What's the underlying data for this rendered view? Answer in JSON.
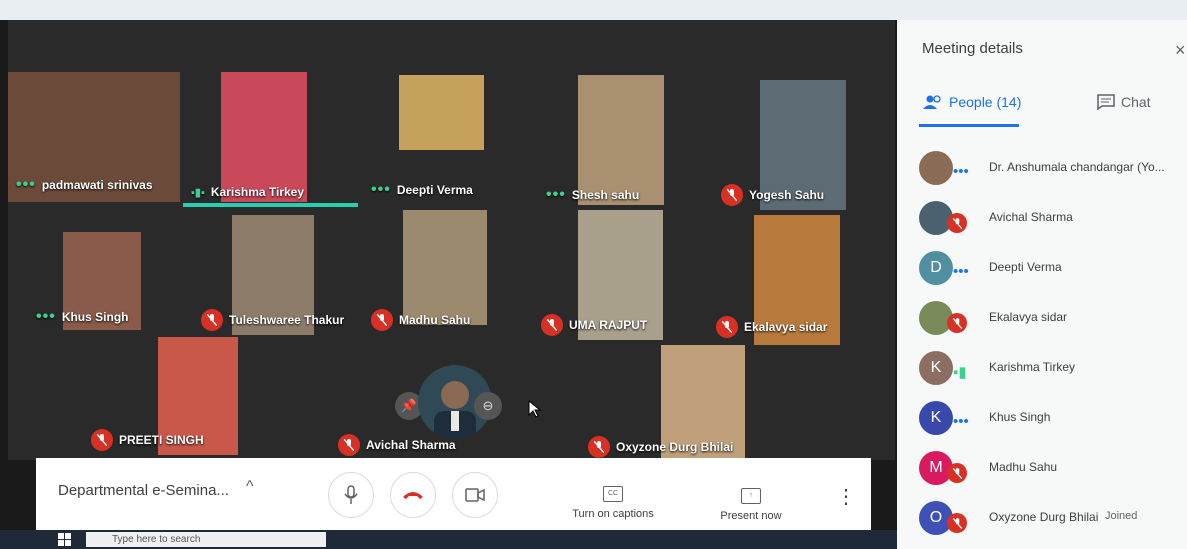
{
  "tiles": [
    {
      "name": "padmawati srinivas",
      "status": "dots"
    },
    {
      "name": "Karishma Tirkey",
      "status": "speaking"
    },
    {
      "name": "Deepti Verma",
      "status": "dots"
    },
    {
      "name": "Shesh sahu",
      "status": "dots"
    },
    {
      "name": "Yogesh Sahu",
      "status": "muted"
    },
    {
      "name": "Khus Singh",
      "status": "dots"
    },
    {
      "name": "Tuleshwaree Thakur",
      "status": "muted"
    },
    {
      "name": "Madhu Sahu",
      "status": "muted"
    },
    {
      "name": "UMA RAJPUT",
      "status": "muted"
    },
    {
      "name": "Ekalavya sidar",
      "status": "muted"
    },
    {
      "name": "PREETI SINGH",
      "status": "muted"
    },
    {
      "name": "Avichal Sharma",
      "status": "muted"
    },
    {
      "name": "Oxyzone Durg Bhilai",
      "status": "muted"
    }
  ],
  "bottombar": {
    "meeting_name": "Departmental e-Semina...",
    "captions_label": "Turn on captions",
    "captions_icon": "CC",
    "present_label": "Present now"
  },
  "sidebar": {
    "title": "Meeting details",
    "people_tab": "People (14)",
    "chat_tab": "Chat",
    "people": [
      {
        "name": "Dr. Anshumala chandangar (Yo...",
        "initial": "",
        "color": "#8a6b55",
        "status": "dots"
      },
      {
        "name": "Avichal Sharma",
        "initial": "",
        "color": "#4a6270",
        "status": "muted"
      },
      {
        "name": "Deepti Verma",
        "initial": "D",
        "color": "#4f8fa0",
        "status": "dots"
      },
      {
        "name": "Ekalavya sidar",
        "initial": "",
        "color": "#7a8a5a",
        "status": "muted"
      },
      {
        "name": "Karishma Tirkey",
        "initial": "K",
        "color": "#8d6e63",
        "status": "speaking"
      },
      {
        "name": "Khus Singh",
        "initial": "K",
        "color": "#3949ab",
        "status": "dots"
      },
      {
        "name": "Madhu Sahu",
        "initial": "M",
        "color": "#d81b60",
        "status": "muted"
      },
      {
        "name": "Oxyzone Durg Bhilai",
        "initial": "O",
        "color": "#3f51b5",
        "status": "muted",
        "joined": "Joined"
      }
    ]
  },
  "taskbar": {
    "search_placeholder": "Type here to search"
  }
}
